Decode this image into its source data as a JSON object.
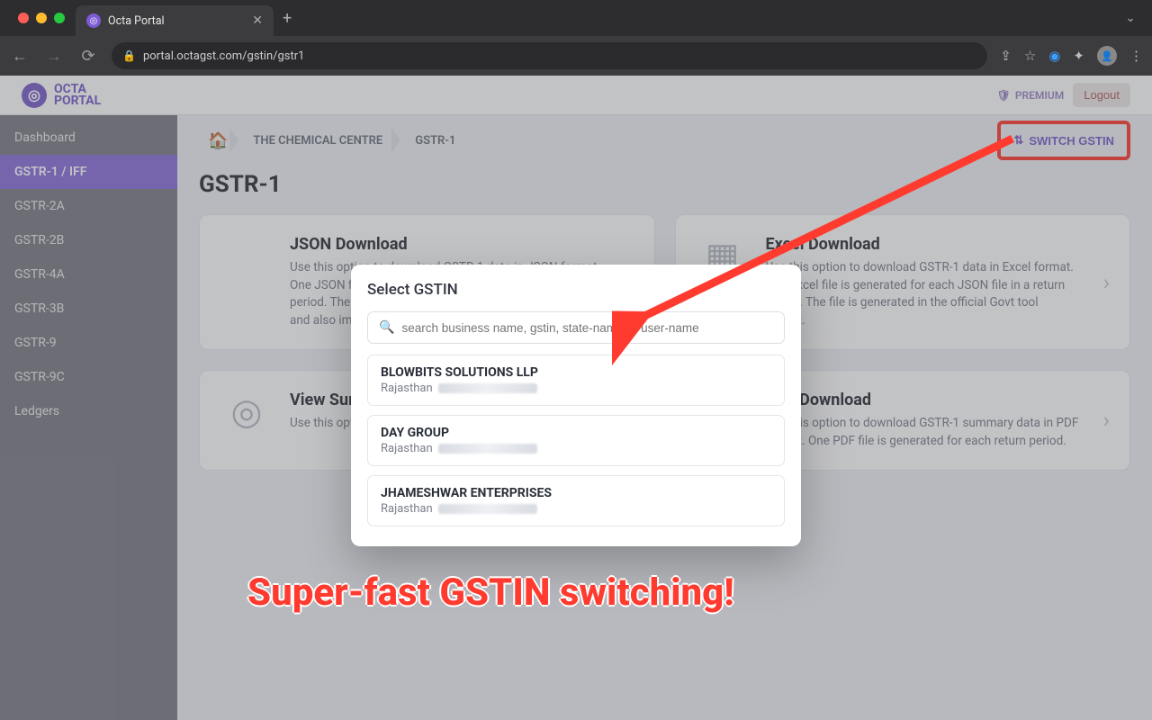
{
  "browser": {
    "tab_title": "Octa Portal",
    "url": "portal.octagst.com/gstin/gstr1"
  },
  "topbar": {
    "brand_line1": "OCTA",
    "brand_line2": "PORTAL",
    "premium_label": "PREMIUM",
    "logout_label": "Logout"
  },
  "sidebar": {
    "items": [
      {
        "label": "Dashboard",
        "active": false
      },
      {
        "label": "GSTR-1 / IFF",
        "active": true
      },
      {
        "label": "GSTR-2A",
        "active": false
      },
      {
        "label": "GSTR-2B",
        "active": false
      },
      {
        "label": "GSTR-4A",
        "active": false
      },
      {
        "label": "GSTR-3B",
        "active": false
      },
      {
        "label": "GSTR-9",
        "active": false
      },
      {
        "label": "GSTR-9C",
        "active": false
      },
      {
        "label": "Ledgers",
        "active": false
      }
    ]
  },
  "breadcrumbs": {
    "items": [
      "THE CHEMICAL CENTRE",
      "GSTR-1"
    ],
    "switch_label": "SWITCH GSTIN"
  },
  "page_title": "GSTR-1",
  "cards": [
    {
      "title": "JSON Download",
      "desc": "Use this option to download GSTR-1 data in JSON format. One JSON file is generated in zip format for each return period. The file can be uploaded directly on Govt portal and also imported in the official Govt tool or Octa GST."
    },
    {
      "title": "Excel Download",
      "desc": "Use this option to download GSTR-1 data in Excel format. One Excel file is generated for each JSON file in a return period. The file is generated in the official Govt tool format."
    },
    {
      "title": "View Summary",
      "desc": "Use this option to view details of the GSTR-1 return."
    },
    {
      "title": "PDF Download",
      "desc": "Use this option to download GSTR-1 summary data in PDF format. One PDF file is generated for each return period."
    }
  ],
  "modal": {
    "title": "Select GSTIN",
    "search_placeholder": "search business name, gstin, state-name or user-name",
    "items": [
      {
        "name": "BLOWBITS SOLUTIONS LLP",
        "state": "Rajasthan"
      },
      {
        "name": "DAY GROUP",
        "state": "Rajasthan"
      },
      {
        "name": "JHAMESHWAR ENTERPRISES",
        "state": "Rajasthan"
      }
    ]
  },
  "annotation": {
    "text": "Super-fast GSTIN switching!"
  }
}
